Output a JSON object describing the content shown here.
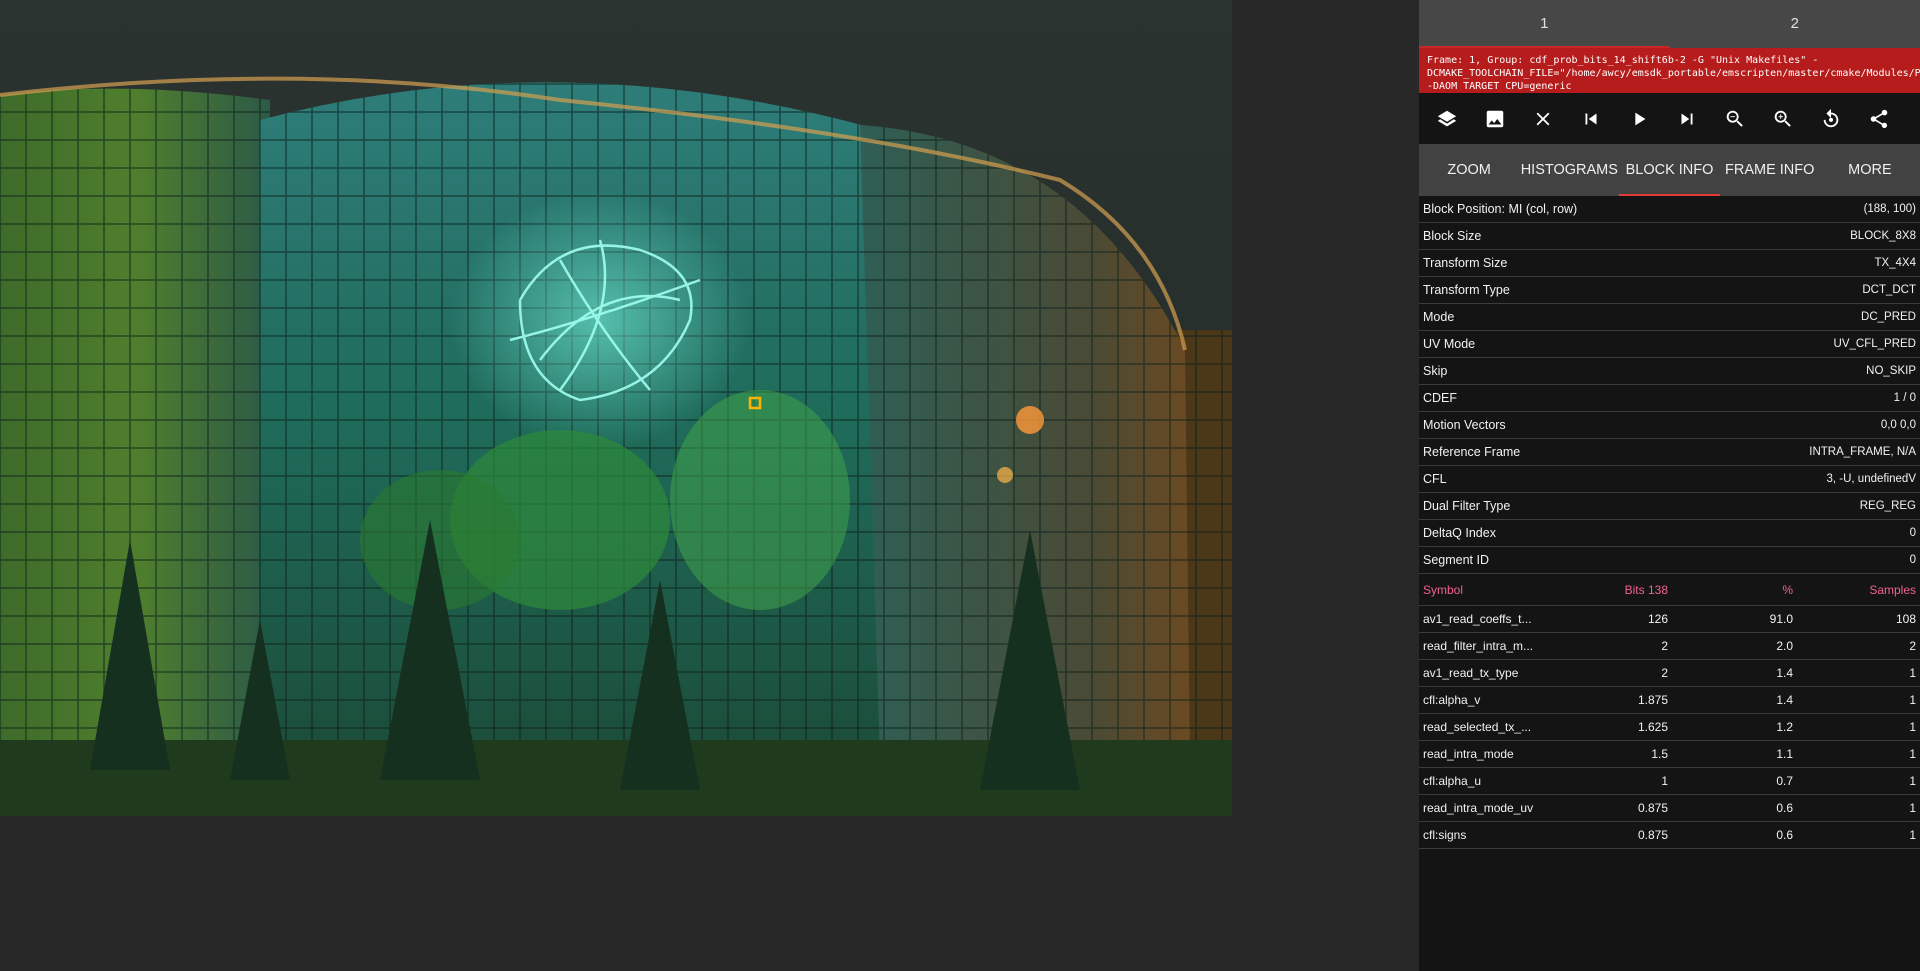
{
  "frame_tabs": [
    "1",
    "2"
  ],
  "banner": "Frame: 1, Group: cdf_prob_bits_14_shift6b-2 -G \"Unix Makefiles\" -DCMAKE_TOOLCHAIN_FILE=\"/home/awcy/emsdk_portable/emscripten/master/cmake/Modules/Platform/Emscripten.cmake\" -DAOM TARGET CPU=generic",
  "toolbar": [
    {
      "icon": "layers-icon"
    },
    {
      "icon": "image-icon"
    },
    {
      "icon": "close-icon"
    },
    {
      "icon": "skip-previous-icon"
    },
    {
      "icon": "play-icon"
    },
    {
      "icon": "skip-next-icon"
    },
    {
      "icon": "zoom-out-icon"
    },
    {
      "icon": "zoom-in-icon"
    },
    {
      "icon": "replay-30-icon"
    },
    {
      "icon": "share-icon"
    }
  ],
  "info_tabs": [
    "ZOOM",
    "HISTOGRAMS",
    "BLOCK INFO",
    "FRAME INFO",
    "MORE"
  ],
  "active_info_tab": "BLOCK INFO",
  "block_info": [
    {
      "key": "Block Position: MI (col, row)",
      "value": "(188, 100)"
    },
    {
      "key": "Block Size",
      "value": "BLOCK_8X8"
    },
    {
      "key": "Transform Size",
      "value": "TX_4X4"
    },
    {
      "key": "Transform Type",
      "value": "DCT_DCT"
    },
    {
      "key": "Mode",
      "value": "DC_PRED"
    },
    {
      "key": "UV Mode",
      "value": "UV_CFL_PRED"
    },
    {
      "key": "Skip",
      "value": "NO_SKIP"
    },
    {
      "key": "CDEF",
      "value": "1 / 0"
    },
    {
      "key": "Motion Vectors",
      "value": "0,0 0,0"
    },
    {
      "key": "Reference Frame",
      "value": "INTRA_FRAME, N/A"
    },
    {
      "key": "CFL",
      "value": "3, -U, undefinedV"
    },
    {
      "key": "Dual Filter Type",
      "value": "REG_REG"
    },
    {
      "key": "DeltaQ Index",
      "value": "0"
    },
    {
      "key": "Segment ID",
      "value": "0"
    }
  ],
  "symbols": {
    "headers": {
      "symbol": "Symbol",
      "bits": "Bits 138",
      "pct": "%",
      "samples": "Samples"
    },
    "rows": [
      {
        "symbol": "av1_read_coeffs_t...",
        "bits": "126",
        "pct": "91.0",
        "samples": "108"
      },
      {
        "symbol": "read_filter_intra_m...",
        "bits": "2",
        "pct": "2.0",
        "samples": "2"
      },
      {
        "symbol": "av1_read_tx_type",
        "bits": "2",
        "pct": "1.4",
        "samples": "1"
      },
      {
        "symbol": "cfl:alpha_v",
        "bits": "1.875",
        "pct": "1.4",
        "samples": "1"
      },
      {
        "symbol": "read_selected_tx_...",
        "bits": "1.625",
        "pct": "1.2",
        "samples": "1"
      },
      {
        "symbol": "read_intra_mode",
        "bits": "1.5",
        "pct": "1.1",
        "samples": "1"
      },
      {
        "symbol": "cfl:alpha_u",
        "bits": "1",
        "pct": "0.7",
        "samples": "1"
      },
      {
        "symbol": "read_intra_mode_uv",
        "bits": "0.875",
        "pct": "0.6",
        "samples": "1"
      },
      {
        "symbol": "cfl:signs",
        "bits": "0.875",
        "pct": "0.6",
        "samples": "1"
      }
    ]
  },
  "colors": {
    "accent": "#e53935",
    "banner": "#b71c1c",
    "symbol_header": "#f06292"
  }
}
